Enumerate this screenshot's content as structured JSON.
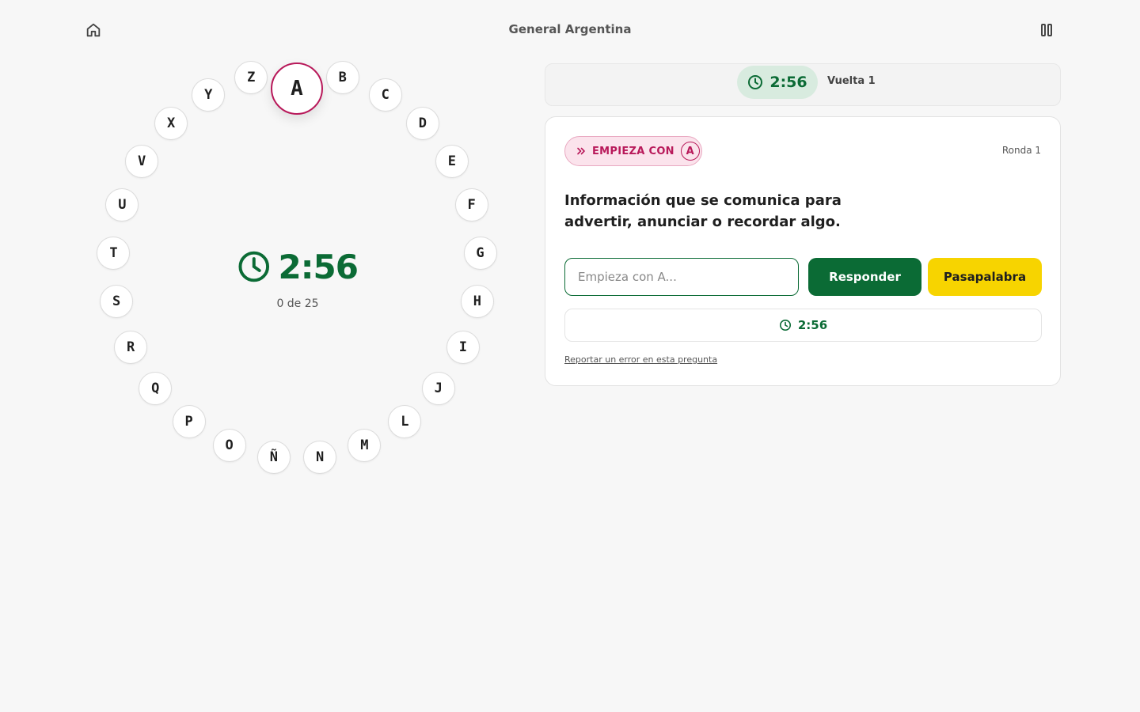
{
  "header": {
    "title": "General Argentina",
    "home_icon": "home-icon",
    "pause_icon": "pause-icon"
  },
  "ring": {
    "letters": [
      "A",
      "B",
      "C",
      "D",
      "E",
      "F",
      "G",
      "H",
      "I",
      "J",
      "L",
      "M",
      "N",
      "Ñ",
      "O",
      "P",
      "Q",
      "R",
      "S",
      "T",
      "U",
      "V",
      "X",
      "Y",
      "Z"
    ],
    "active_letter": "A",
    "timer": "2:56",
    "progress": "0 de 25"
  },
  "status": {
    "timer": "2:56",
    "lap": "Vuelta 1"
  },
  "question_card": {
    "starts_with_label": "EMPIEZA CON",
    "starts_with_letter": "A",
    "round": "Ronda 1",
    "question": "Información que se comunica para advertir, anunciar o recordar algo.",
    "input_placeholder": "Empieza con A...",
    "input_value": "",
    "answer_button": "Responder",
    "pass_button": "Pasapalabra",
    "timer": "2:56",
    "report_link": "Reportar un error en esta pregunta"
  },
  "colors": {
    "accent_green": "#0b6b35",
    "accent_magenta": "#b8195a",
    "pass_yellow": "#f7d400"
  }
}
